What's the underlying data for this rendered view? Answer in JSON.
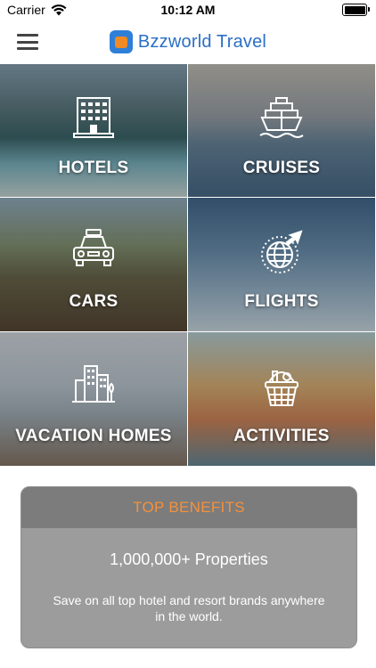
{
  "status_bar": {
    "carrier": "Carrier",
    "time": "10:12 AM",
    "icons": [
      "wifi-icon",
      "battery-icon"
    ]
  },
  "header": {
    "brand_name": "Bzzworld Travel",
    "menu_icon": "hamburger-menu-icon",
    "logo_icon": "bag-logo-icon"
  },
  "categories": [
    {
      "label": "HOTELS",
      "icon": "hotel-building-icon"
    },
    {
      "label": "CRUISES",
      "icon": "cruise-ship-icon"
    },
    {
      "label": "CARS",
      "icon": "taxi-car-icon"
    },
    {
      "label": "FLIGHTS",
      "icon": "globe-plane-icon"
    },
    {
      "label": "VACATION HOMES",
      "icon": "city-buildings-icon"
    },
    {
      "label": "ACTIVITIES",
      "icon": "picnic-basket-icon"
    }
  ],
  "benefits": {
    "title": "TOP BENEFITS",
    "headline": "1,000,000+ Properties",
    "description": "Save on all top hotel and resort brands anywhere in the world."
  },
  "colors": {
    "accent": "#f5913a",
    "brand_blue": "#2b6fc4",
    "panel_header": "#7c7c7c",
    "panel_body": "#9c9c9c"
  }
}
